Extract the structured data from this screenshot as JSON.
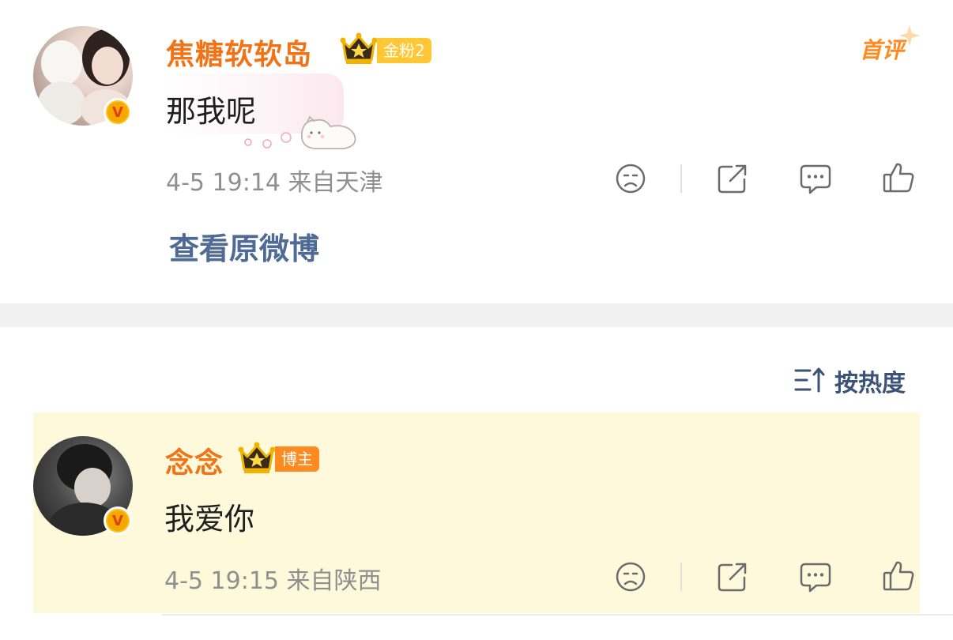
{
  "comment": {
    "username": "焦糖软软岛",
    "fan_badge": "金粉2",
    "first_comment_tag": "首评",
    "text": "那我呢",
    "meta": "4-5 19:14  来自天津",
    "view_original": "查看原微博",
    "avatar_badge": "V"
  },
  "sort": {
    "label": "按热度",
    "icon": "sort-icon"
  },
  "reply": {
    "username": "念念",
    "host_badge": "博主",
    "text": "我爱你",
    "meta": "4-5 19:15  来自陕西",
    "avatar_badge": "V"
  },
  "actions": [
    "frown-icon",
    "share-icon",
    "comment-icon",
    "like-icon"
  ],
  "colors": {
    "username": "#f27216",
    "link": "#4f6b95",
    "meta": "#8f8f8f",
    "highlight_bg": "#fef9db",
    "fan_badge_bg": "#ffc733",
    "host_badge_bg": "#ff8a1f"
  }
}
